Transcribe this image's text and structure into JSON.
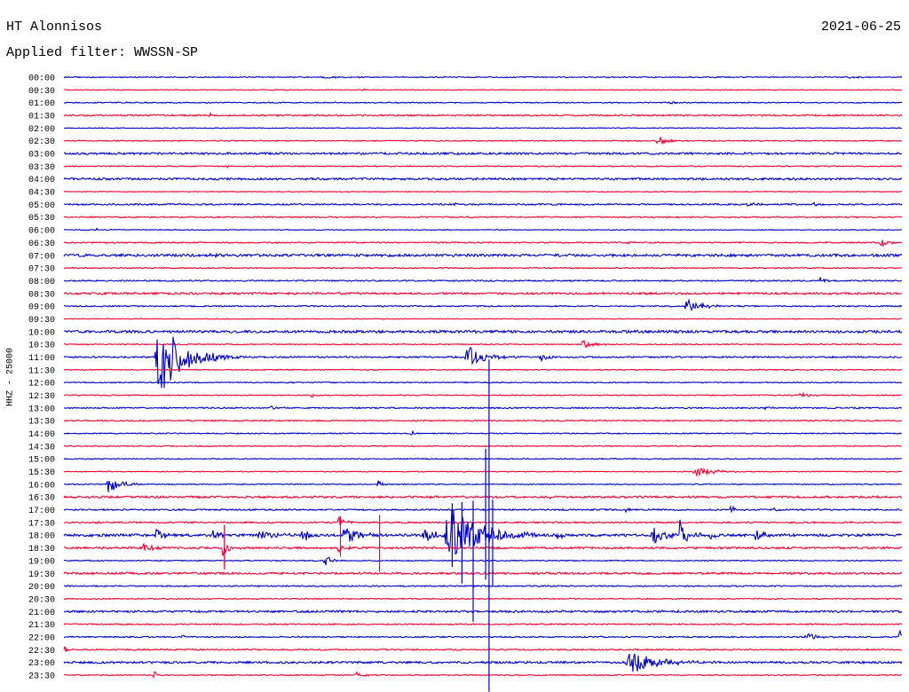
{
  "chart_data": {
    "type": "line",
    "title": "HT Alonnisos",
    "date": "2021-06-25",
    "filter": "Applied filter: WWSSN-SP",
    "ylabel": "HHZ - 25000",
    "row_minutes": 30,
    "colors": [
      "#0000cc",
      "#ff0033"
    ],
    "rows": [
      "00:00",
      "00:30",
      "01:00",
      "01:30",
      "02:00",
      "02:30",
      "03:00",
      "03:30",
      "04:00",
      "04:30",
      "05:00",
      "05:30",
      "06:00",
      "06:30",
      "07:00",
      "07:30",
      "08:00",
      "08:30",
      "09:00",
      "09:30",
      "10:00",
      "10:30",
      "11:00",
      "11:30",
      "12:00",
      "12:30",
      "13:00",
      "13:30",
      "14:00",
      "14:30",
      "15:00",
      "15:30",
      "16:00",
      "16:30",
      "17:00",
      "17:30",
      "18:00",
      "18:30",
      "19:00",
      "19:30",
      "20:00",
      "20:30",
      "21:00",
      "21:30",
      "22:00",
      "22:30",
      "23:00",
      "23:30"
    ],
    "noise": [
      0.04,
      0.03,
      0.04,
      0.06,
      0.03,
      0.04,
      0.08,
      0.04,
      0.08,
      0.03,
      0.06,
      0.05,
      0.03,
      0.05,
      0.1,
      0.04,
      0.05,
      0.08,
      0.05,
      0.03,
      0.1,
      0.04,
      0.06,
      0.04,
      0.04,
      0.04,
      0.05,
      0.05,
      0.04,
      0.04,
      0.04,
      0.03,
      0.04,
      0.08,
      0.06,
      0.06,
      0.1,
      0.08,
      0.04,
      0.08,
      0.05,
      0.04,
      0.08,
      0.05,
      0.05,
      0.05,
      0.08,
      0.04
    ],
    "events": [
      {
        "row": "00:00",
        "start": 9.15,
        "duration": 3.0,
        "amplitude": 0.1
      },
      {
        "row": "00:00",
        "start": 27.9,
        "duration": 1.4,
        "amplitude": 0.08
      },
      {
        "row": "00:30",
        "start": 10.7,
        "duration": 0.2,
        "amplitude": 0.2
      },
      {
        "row": "01:00",
        "start": 21.5,
        "duration": 1.3,
        "amplitude": 0.12
      },
      {
        "row": "01:30",
        "start": 5.2,
        "duration": 0.5,
        "amplitude": 0.12
      },
      {
        "row": "02:30",
        "start": 21.2,
        "duration": 0.8,
        "amplitude": 0.45
      },
      {
        "row": "03:30",
        "start": 5.8,
        "duration": 0.4,
        "amplitude": 0.12
      },
      {
        "row": "05:00",
        "start": 13.9,
        "duration": 0.6,
        "amplitude": 0.12
      },
      {
        "row": "05:00",
        "start": 24.4,
        "duration": 1.3,
        "amplitude": 0.14
      },
      {
        "row": "05:00",
        "start": 26.8,
        "duration": 0.3,
        "amplitude": 0.22
      },
      {
        "row": "06:00",
        "start": 1.15,
        "duration": 0.1,
        "amplitude": 0.15
      },
      {
        "row": "06:30",
        "start": 20.1,
        "duration": 0.8,
        "amplitude": 0.12
      },
      {
        "row": "06:30",
        "start": 29.2,
        "duration": 0.8,
        "amplitude": 0.35
      },
      {
        "row": "07:00",
        "start": 5.2,
        "duration": 0.4,
        "amplitude": 0.4
      },
      {
        "row": "08:00",
        "start": 27.0,
        "duration": 0.6,
        "amplitude": 0.28
      },
      {
        "row": "09:00",
        "start": 22.2,
        "duration": 1.6,
        "amplitude": 0.55
      },
      {
        "row": "10:30",
        "start": 18.5,
        "duration": 1.2,
        "amplitude": 0.32
      },
      {
        "row": "11:00",
        "start": 3.25,
        "duration": 2.5,
        "amplitude": 3.0
      },
      {
        "row": "11:00",
        "start": 14.35,
        "duration": 1.5,
        "amplitude": 0.95
      },
      {
        "row": "11:00",
        "start": 16.95,
        "duration": 1.3,
        "amplitude": 0.28
      },
      {
        "row": "12:30",
        "start": 8.85,
        "duration": 0.2,
        "amplitude": 0.22
      },
      {
        "row": "12:30",
        "start": 26.3,
        "duration": 1.0,
        "amplitude": 0.22
      },
      {
        "row": "13:00",
        "start": 7.25,
        "duration": 1.2,
        "amplitude": 0.16
      },
      {
        "row": "13:00",
        "start": 25.05,
        "duration": 1.0,
        "amplitude": 0.12
      },
      {
        "row": "14:00",
        "start": 12.4,
        "duration": 0.3,
        "amplitude": 0.38
      },
      {
        "row": "15:30",
        "start": 22.5,
        "duration": 1.9,
        "amplitude": 0.38
      },
      {
        "row": "16:00",
        "start": 1.5,
        "duration": 1.4,
        "amplitude": 0.65
      },
      {
        "row": "16:00",
        "start": 11.2,
        "duration": 0.5,
        "amplitude": 0.32
      },
      {
        "row": "16:00",
        "start": 15.8,
        "duration": 0.1,
        "amplitude": 0.22
      },
      {
        "row": "16:30",
        "start": 17.4,
        "duration": 0.3,
        "amplitude": 0.2
      },
      {
        "row": "17:00",
        "start": 20.1,
        "duration": 0.2,
        "amplitude": 0.32
      },
      {
        "row": "17:00",
        "start": 23.8,
        "duration": 0.8,
        "amplitude": 0.3
      },
      {
        "row": "17:00",
        "start": 25.4,
        "duration": 0.2,
        "amplitude": 0.32
      },
      {
        "row": "17:30",
        "start": 1.2,
        "duration": 0.1,
        "amplitude": 0.4
      },
      {
        "row": "17:30",
        "start": 9.8,
        "duration": 0.6,
        "amplitude": 0.6
      },
      {
        "row": "18:00",
        "start": 3.25,
        "duration": 0.8,
        "amplitude": 0.6
      },
      {
        "row": "18:00",
        "start": 5.3,
        "duration": 0.8,
        "amplitude": 0.6
      },
      {
        "row": "18:00",
        "start": 6.9,
        "duration": 1.5,
        "amplitude": 0.5
      },
      {
        "row": "18:00",
        "start": 8.5,
        "duration": 0.5,
        "amplitude": 0.9
      },
      {
        "row": "18:00",
        "start": 9.95,
        "duration": 1.5,
        "amplitude": 0.8
      },
      {
        "row": "18:00",
        "start": 12.8,
        "duration": 1.0,
        "amplitude": 0.8
      },
      {
        "row": "18:00",
        "start": 13.6,
        "duration": 3.0,
        "amplitude": 2.5
      },
      {
        "row": "18:00",
        "start": 17.6,
        "duration": 0.5,
        "amplitude": 0.5
      },
      {
        "row": "18:00",
        "start": 21.0,
        "duration": 1.5,
        "amplitude": 0.7
      },
      {
        "row": "18:00",
        "start": 22.0,
        "duration": 0.8,
        "amplitude": 1.3
      },
      {
        "row": "18:00",
        "start": 23.1,
        "duration": 0.5,
        "amplitude": 0.4
      },
      {
        "row": "18:00",
        "start": 24.7,
        "duration": 1.0,
        "amplitude": 0.5
      },
      {
        "row": "18:30",
        "start": 2.8,
        "duration": 1.0,
        "amplitude": 0.4
      },
      {
        "row": "18:30",
        "start": 5.65,
        "duration": 0.6,
        "amplitude": 0.8
      },
      {
        "row": "18:30",
        "start": 9.8,
        "duration": 0.5,
        "amplitude": 0.6
      },
      {
        "row": "19:00",
        "start": 9.3,
        "duration": 0.6,
        "amplitude": 0.6
      },
      {
        "row": "22:00",
        "start": 4.2,
        "duration": 0.15,
        "amplitude": 0.4
      },
      {
        "row": "22:00",
        "start": 26.5,
        "duration": 1.0,
        "amplitude": 0.4
      },
      {
        "row": "22:00",
        "start": 29.9,
        "duration": 0.1,
        "amplitude": 1.2
      },
      {
        "row": "22:30",
        "start": 0.0,
        "duration": 0.3,
        "amplitude": 0.5
      },
      {
        "row": "22:30",
        "start": 4.4,
        "duration": 0.7,
        "amplitude": 0.12
      },
      {
        "row": "23:00",
        "start": 20.1,
        "duration": 2.5,
        "amplitude": 1.0
      },
      {
        "row": "23:30",
        "start": 3.2,
        "duration": 0.2,
        "amplitude": 0.55
      },
      {
        "row": "23:30",
        "start": 10.4,
        "duration": 0.8,
        "amplitude": 0.22
      }
    ],
    "spikes": [
      {
        "row": "18:00",
        "minute": 15.22,
        "up": 13.8,
        "down": 12.3
      },
      {
        "row": "18:00",
        "minute": 14.65,
        "up": 2.7,
        "down": 6.8
      },
      {
        "row": "18:00",
        "minute": 14.25,
        "up": 2.6,
        "down": 3.8
      },
      {
        "row": "18:00",
        "minute": 15.1,
        "up": 6.8,
        "down": 3.5
      },
      {
        "row": "18:00",
        "minute": 13.9,
        "up": 2.5,
        "down": 2.5
      },
      {
        "row": "18:00",
        "minute": 15.35,
        "up": 2.8,
        "down": 4.0
      },
      {
        "row": "18:00",
        "minute": 5.75,
        "up": 0.8,
        "down": 2.5
      },
      {
        "row": "17:30",
        "minute": 11.3,
        "up": 0.6,
        "down": 3.9
      },
      {
        "row": "17:30",
        "minute": 9.9,
        "up": 0.5,
        "down": 2.7
      },
      {
        "row": "18:30",
        "minute": 5.75,
        "up": 1.8,
        "down": 1.7
      }
    ]
  }
}
